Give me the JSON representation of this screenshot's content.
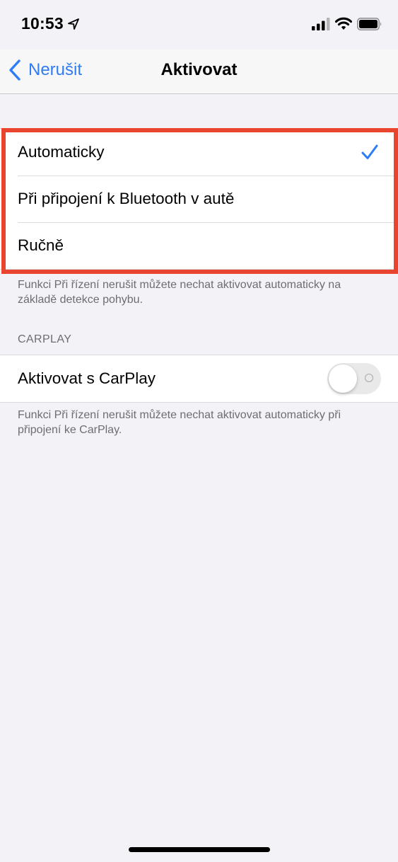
{
  "status_bar": {
    "time": "10:53",
    "icons": [
      "location-arrow-icon",
      "cellular-signal-icon",
      "wifi-icon",
      "battery-icon"
    ]
  },
  "nav": {
    "back_label": "Nerušit",
    "title": "Aktivovat"
  },
  "options": {
    "items": [
      {
        "label": "Automaticky",
        "selected": true
      },
      {
        "label": "Při připojení k Bluetooth v autě",
        "selected": false
      },
      {
        "label": "Ručně",
        "selected": false
      }
    ],
    "footer": "Funkci Při řízení nerušit můžete nechat aktivovat automaticky na základě detekce pohybu."
  },
  "carplay": {
    "header": "CARPLAY",
    "row_label": "Aktivovat s CarPlay",
    "toggle_on": false,
    "footer": "Funkci Při řízení nerušit můžete nechat aktivovat automaticky při připojení ke CarPlay."
  },
  "colors": {
    "accent": "#2f7cf6",
    "highlight": "#e8442e",
    "background": "#f2f2f7",
    "secondary_text": "#6d6d72"
  }
}
